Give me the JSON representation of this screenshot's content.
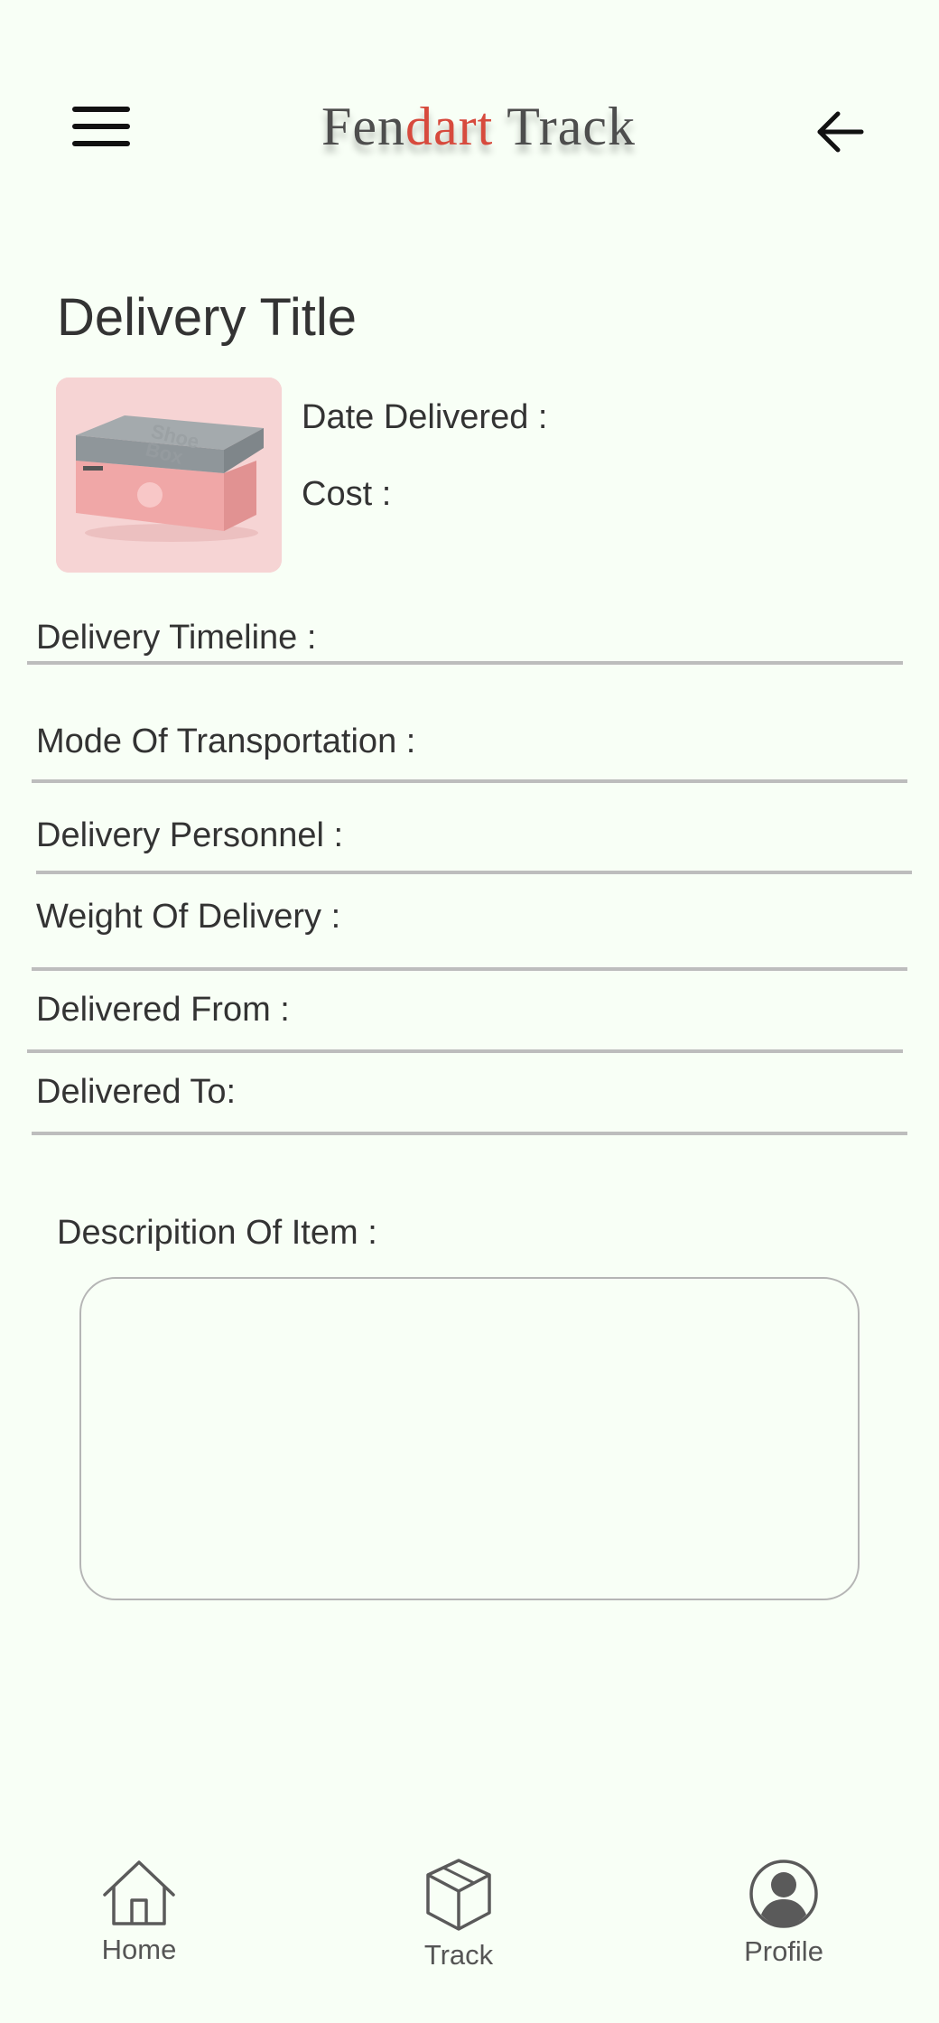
{
  "header": {
    "brand_part1": "Fen",
    "brand_accent": "dart",
    "brand_part2": " Track",
    "accent_color": "#d74a3d"
  },
  "delivery": {
    "title": "Delivery Title",
    "date_delivered_label": "Date Delivered :",
    "cost_label": "Cost :"
  },
  "fields": {
    "timeline": "Delivery Timeline :",
    "transport": "Mode Of Transportation :",
    "personnel": "Delivery Personnel :",
    "weight": "Weight Of Delivery :",
    "from": "Delivered From :",
    "to": "Delivered To:"
  },
  "description": {
    "label": "Descripition Of Item :",
    "value": ""
  },
  "nav": {
    "home": "Home",
    "track": "Track",
    "profile": "Profile"
  },
  "icons": {
    "menu": "hamburger-menu-icon",
    "back": "arrow-left-icon",
    "home": "house-icon",
    "track": "package-box-icon",
    "profile": "user-circle-icon"
  },
  "colors": {
    "background": "#f8fff6",
    "thumb_background": "#f6d4d4",
    "divider": "#bdbdbd"
  }
}
